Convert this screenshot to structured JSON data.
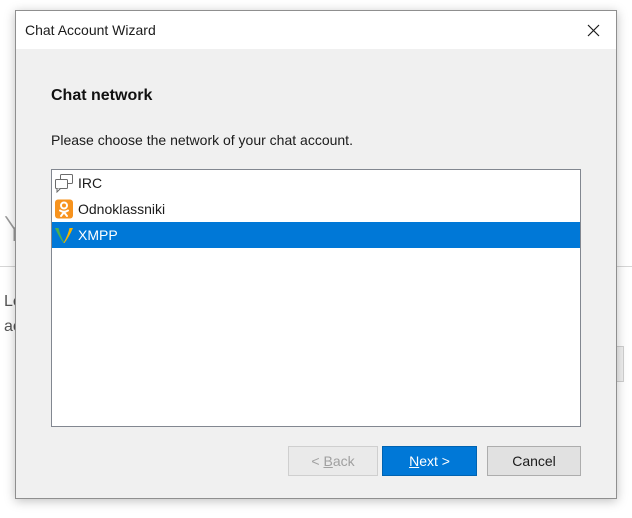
{
  "background": {
    "heading_fragment": "Y",
    "text_line_1": "Le",
    "text_line_2": "ac"
  },
  "dialog": {
    "title": "Chat Account Wizard",
    "close_icon": "close-icon",
    "page_title": "Chat network",
    "description": "Please choose the network of your chat account.",
    "networks": [
      {
        "label": "IRC",
        "icon": "irc-icon",
        "selected": false
      },
      {
        "label": "Odnoklassniki",
        "icon": "odnoklassniki-icon",
        "selected": false
      },
      {
        "label": "XMPP",
        "icon": "xmpp-icon",
        "selected": true
      }
    ],
    "buttons": {
      "back": {
        "prefix": "< ",
        "accel": "B",
        "rest": "ack",
        "enabled": false
      },
      "next": {
        "accel": "N",
        "rest": "ext >",
        "enabled": true
      },
      "cancel": {
        "label": "Cancel",
        "enabled": true
      }
    }
  },
  "colors": {
    "selection": "#0078d7",
    "dialog_bg": "#f0f0f0",
    "odnoklassniki": "#f7931e",
    "xmpp_green": "#4caf50",
    "xmpp_yellow": "#f4b400"
  }
}
